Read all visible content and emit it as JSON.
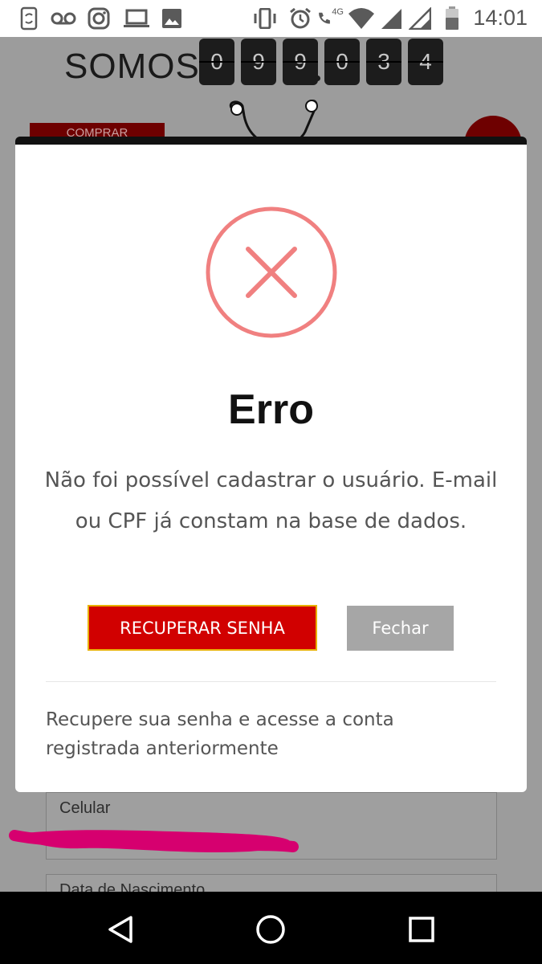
{
  "status_bar": {
    "time": "14:01",
    "network_label": "4G",
    "icons": [
      "sync-phone-icon",
      "voicemail-icon",
      "instagram-icon",
      "laptop-icon",
      "image-icon",
      "vibrate-icon",
      "alarm-icon",
      "wifi-call-icon",
      "wifi-icon",
      "signal-icon",
      "signal-icon",
      "battery-icon"
    ]
  },
  "background_page": {
    "headline": "SOMOS",
    "counter_digits": [
      "0",
      "9",
      "9",
      "0",
      "3",
      "4"
    ],
    "buy_button_label": "COMPRAR",
    "fields": [
      {
        "label": "Celular"
      },
      {
        "label": "Data de Nascimento"
      }
    ]
  },
  "modal": {
    "icon": "error-x-icon",
    "title": "Erro",
    "message": "Não foi possível cadastrar o usuário. E-mail ou CPF já constam na base de dados.",
    "recover_button_label": "RECUPERAR SENHA",
    "close_button_label": "Fechar",
    "footer_text": "Recupere sua senha e acesse a conta registrada anteriormente"
  },
  "colors": {
    "error_ring": "#f08080",
    "recover_button": "#d10000",
    "recover_button_border": "#e8b000",
    "close_button": "#a6a6a6"
  },
  "nav_bar": {
    "buttons": [
      "back-icon",
      "home-icon",
      "recents-icon"
    ]
  }
}
